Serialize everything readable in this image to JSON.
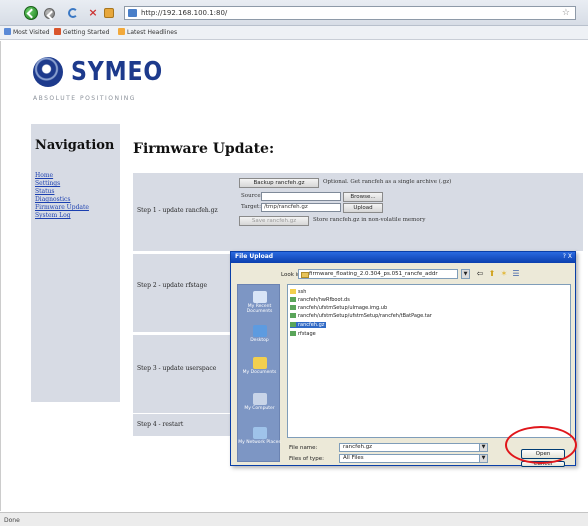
{
  "browser": {
    "url": "http://192.168.100.1:80/",
    "bookmarks": [
      "Most Visited",
      "Getting Started",
      "Latest Headlines"
    ]
  },
  "logo": {
    "word": "SYMEO",
    "tagline": "ABSOLUTE POSITIONING"
  },
  "navigation": {
    "title": "Navigation",
    "links": [
      "Home",
      "Settings",
      "Status",
      "Diagnostics",
      "Firmware Update",
      "System Log"
    ]
  },
  "main": {
    "title": "Firmware Update:",
    "steps": [
      {
        "label": "Step 1 - update rancfeh.gz",
        "backup_button": "Backup rancfeh.gz",
        "backup_note": "Optional. Get rancfeh as a single archive (.gz)",
        "source_label": "Source:",
        "source_value": "",
        "browse_button": "Browse...",
        "target_label": "Target:",
        "target_value": "/tmp/rancfeh.gz",
        "upload_button": "Upload",
        "save_button": "Save rancfeh.gz",
        "save_note": "Store rancfeh.gz in non-volatile memory"
      },
      {
        "label": "Step 2 - update rfstage"
      },
      {
        "label": "Step 3 - update userspace"
      },
      {
        "label": "Step 4 - restart"
      }
    ]
  },
  "dialog": {
    "title": "File Upload",
    "close": "? X",
    "look_in_label": "Look in:",
    "look_in_value": "firmware_floating_2.0.304_ps.051_rancfe_addr",
    "places": [
      "My Recent Documents",
      "Desktop",
      "My Documents",
      "My Computer",
      "My Network Places"
    ],
    "files": [
      "ssh",
      "rancfeh/hwRfboot.ds",
      "rancfeh/ufstmSetup/uImage.img.ub",
      "rancfeh/ufstmSetup/ufstmSetup/rancfeh/tBatPage.tar",
      "rancfeh.gz",
      "rfstage"
    ],
    "selected_file_index": 4,
    "file_name_label": "File name:",
    "file_name_value": "rancfeh.gz",
    "file_type_label": "Files of type:",
    "file_type_value": "All Files",
    "open_button": "Open",
    "cancel_button": "Cancel"
  },
  "status": {
    "text": "Done"
  },
  "colors": {
    "panel": "#d7dbe4",
    "brand": "#1d3a8c",
    "dialog_title": "#0b3fae",
    "selection": "#316ac5",
    "highlight_ring": "#e0161b"
  }
}
